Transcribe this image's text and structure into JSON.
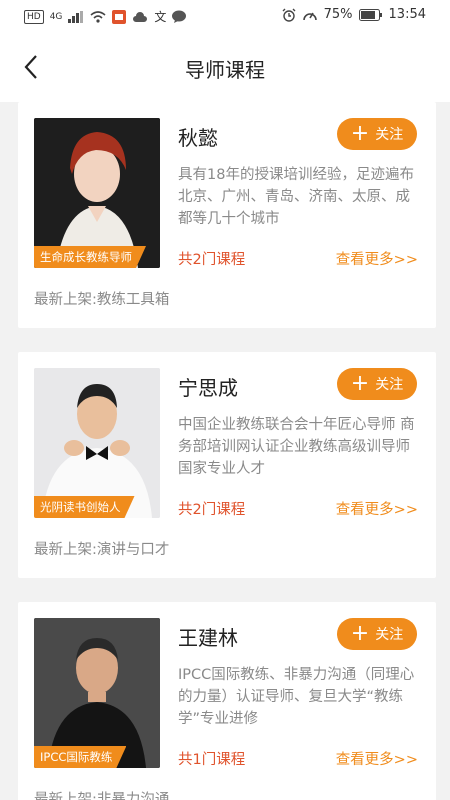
{
  "status_bar": {
    "left_chips": [
      "HD",
      "4G"
    ],
    "battery_percent": "75%",
    "time": "13:54"
  },
  "header": {
    "title": "导师课程"
  },
  "colors": {
    "accent": "#f08c1c",
    "course_count": "#e0532c",
    "muted": "#8a8a8a"
  },
  "mentors": [
    {
      "name": "秋懿",
      "tag": "生命成长教练导师",
      "follow_label": "关注",
      "desc": "具有18年的授课培训经验，足迹遍布北京、广州、青岛、济南、太原、成都等几十个城市",
      "course_count": "共2门课程",
      "more_label": "查看更多>>",
      "latest": "最新上架:教练工具箱"
    },
    {
      "name": "宁思成",
      "tag": "光阴读书创始人",
      "follow_label": "关注",
      "desc": "中国企业教练联合会十年匠心导师 商务部培训网认证企业教练高级训导师 国家专业人才",
      "course_count": "共2门课程",
      "more_label": "查看更多>>",
      "latest": "最新上架:演讲与口才"
    },
    {
      "name": "王建林",
      "tag": "IPCC国际教练",
      "follow_label": "关注",
      "desc": "IPCC国际教练、非暴力沟通（同理心的力量）认证导师、复旦大学“教练学”专业进修",
      "course_count": "共1门课程",
      "more_label": "查看更多>>",
      "latest": "最新上架:非暴力沟通"
    }
  ]
}
